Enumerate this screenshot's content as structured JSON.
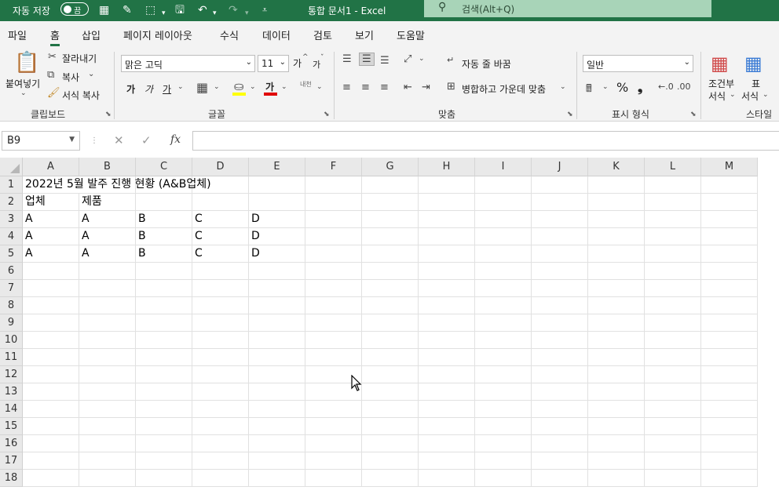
{
  "titlebar": {
    "autosave_label": "자동 저장",
    "autosave_state": "끔",
    "doc_title": "통합 문서1  -  Excel",
    "search_placeholder": "검색(Alt+Q)"
  },
  "menu": {
    "items": [
      "파일",
      "홈",
      "삽입",
      "페이지 레이아웃",
      "수식",
      "데이터",
      "검토",
      "보기",
      "도움말"
    ],
    "active": "홈"
  },
  "ribbon": {
    "clipboard": {
      "paste": "붙여넣기",
      "cut": "잘라내기",
      "copy": "복사",
      "format_painter": "서식 복사",
      "group": "클립보드"
    },
    "font": {
      "font_name": "맑은 고딕",
      "font_size": "11",
      "bold": "가",
      "italic": "가",
      "underline": "가",
      "grow": "가",
      "shrink": "가",
      "font_color_glyph": "가",
      "phonetic": "내천",
      "group": "글꼴"
    },
    "alignment": {
      "wrap": "자동 줄 바꿈",
      "merge": "병합하고 가운데 맞춤",
      "group": "맞춤"
    },
    "number": {
      "format": "일반",
      "percent": "%",
      "comma": "❟",
      "group": "표시 형식"
    },
    "styles": {
      "conditional_line1": "조건부",
      "conditional_line2": "서식",
      "table_line1": "표",
      "table_line2": "서식",
      "group": "스타일"
    }
  },
  "formula_bar": {
    "name_box": "B9",
    "cancel": "✕",
    "enter": "✓",
    "fx": "fx",
    "value": ""
  },
  "sheet": {
    "columns": [
      "A",
      "B",
      "C",
      "D",
      "E",
      "F",
      "G",
      "H",
      "I",
      "J",
      "K",
      "L",
      "M"
    ],
    "rows": [
      "1",
      "2",
      "3",
      "4",
      "5",
      "6",
      "7",
      "8",
      "9",
      "10",
      "11",
      "12",
      "13",
      "14",
      "15",
      "16",
      "17",
      "18"
    ],
    "cells": {
      "r1": [
        "2022년 5월 발주 진행 현황 (A&B업체)",
        "",
        "",
        "",
        ""
      ],
      "r2": [
        "업체",
        "제품",
        "",
        "",
        ""
      ],
      "r3": [
        "A",
        "A",
        "B",
        "C",
        "D"
      ],
      "r4": [
        "A",
        "A",
        "B",
        "C",
        "D"
      ],
      "r5": [
        "A",
        "A",
        "B",
        "C",
        "D"
      ]
    }
  }
}
